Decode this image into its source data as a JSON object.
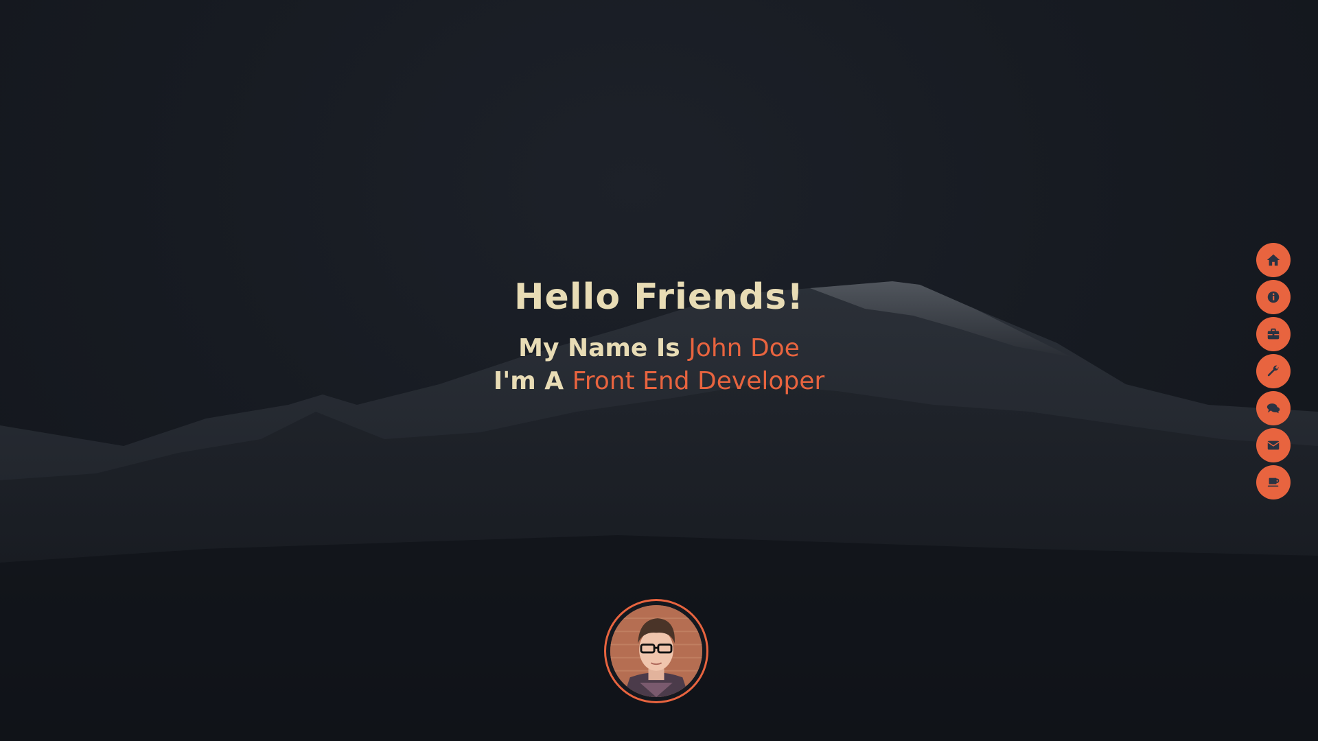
{
  "hero": {
    "greeting": "Hello Friends!",
    "name_prefix": "My Name Is ",
    "name": "John Doe",
    "role_prefix": "I'm A ",
    "role": "Front End Developer"
  },
  "nav": [
    {
      "icon": "home-icon"
    },
    {
      "icon": "info-icon"
    },
    {
      "icon": "briefcase-icon"
    },
    {
      "icon": "wrench-icon"
    },
    {
      "icon": "comments-icon"
    },
    {
      "icon": "envelope-icon"
    },
    {
      "icon": "coffee-icon"
    }
  ],
  "colors": {
    "accent": "#e8643f",
    "text": "#e8dcb5",
    "background": "#14181f",
    "icon": "#2a3342"
  }
}
